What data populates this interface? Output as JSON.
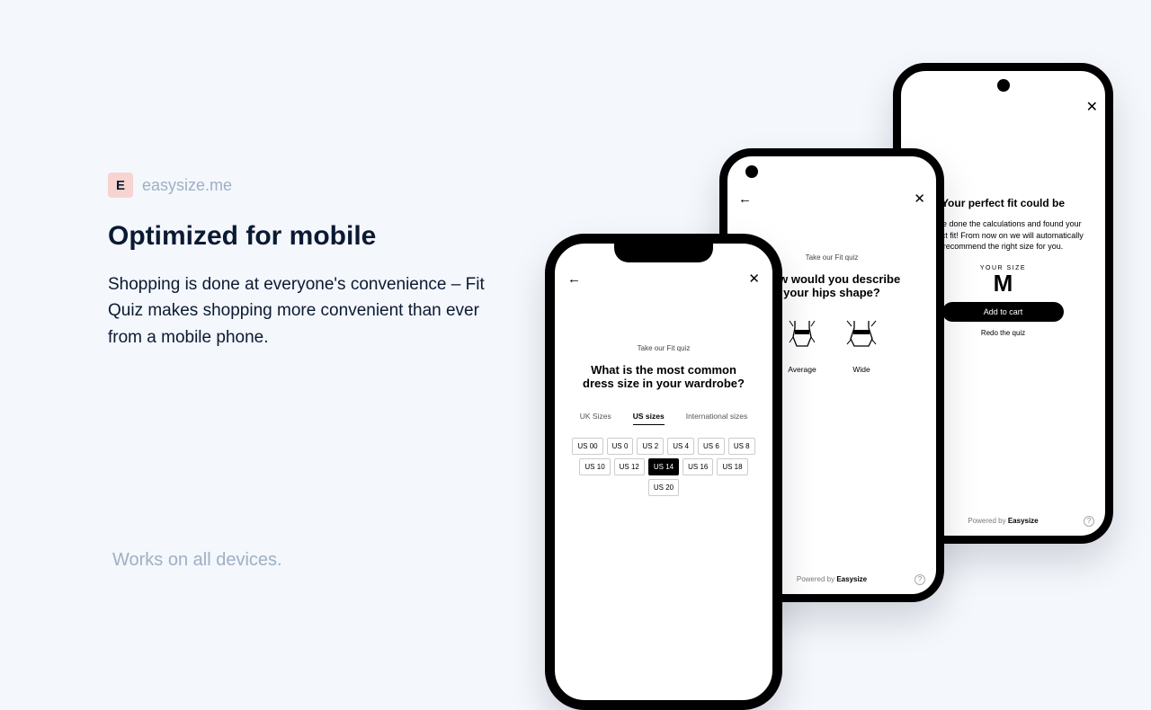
{
  "brand": {
    "initial": "E",
    "name": "easysize.me"
  },
  "headline": "Optimized for mobile",
  "body": "Shopping is done at everyone's convenience – Fit Quiz makes shopping more convenient than ever from a mobile phone.",
  "works_on": "Works on all devices.",
  "common": {
    "take_quiz": "Take our Fit quiz",
    "powered_prefix": "Powered by ",
    "powered_brand": "Easysize",
    "help_glyph": "?"
  },
  "phone1": {
    "question": "What is the most common dress size in your wardrobe?",
    "tabs": {
      "uk": "UK Sizes",
      "us": "US sizes",
      "intl": "International sizes"
    },
    "sizes": [
      "US 00",
      "US 0",
      "US 2",
      "US 4",
      "US 6",
      "US 8",
      "US 10",
      "US 12",
      "US 14",
      "US 16",
      "US 18",
      "US 20"
    ],
    "selected": "US 14"
  },
  "phone2": {
    "question": "How would you describe your hips shape?",
    "options": {
      "average": "Average",
      "wide": "Wide"
    }
  },
  "phone3": {
    "title": "Your perfect fit could be",
    "desc": "We've done the calculations and found your perfect fit! From now on we will automatically recommend the right size for you.",
    "your_size_label": "YOUR SIZE",
    "size": "M",
    "add_to_cart": "Add to cart",
    "redo": "Redo the quiz"
  }
}
